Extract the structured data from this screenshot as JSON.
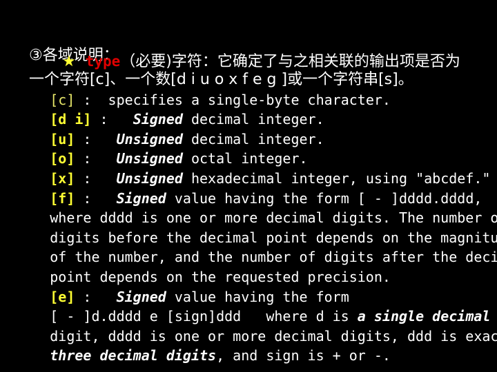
{
  "slide": {
    "background_color": "#000000",
    "text_color": "#ffffff",
    "accent_yellow": "#ffff33",
    "accent_yellow_dim": "#e8e86a",
    "accent_red": "#e00000",
    "heading": "③各域说明：",
    "bullet_icon": "★",
    "bullet": {
      "keyword": "type",
      "text_after_keyword": "（必要)字符：它确定了与之相关联的输出项是否为",
      "continuation": "一个字符[c]、一个数[d i u o x f e g ]或一个字符串[s]。"
    },
    "entries": [
      {
        "tag": "[c]",
        "tag_style": "dim",
        "colon": ":",
        "emphasis": "",
        "text": "  specifies a single-byte character."
      },
      {
        "tag": "[d i]",
        "tag_style": "bold",
        "colon": ":",
        "emphasis": "Signed",
        "text": " decimal integer."
      },
      {
        "tag": "[u]",
        "tag_style": "bold",
        "colon": ":",
        "emphasis": "Unsigned",
        "text": " decimal integer."
      },
      {
        "tag": "[o]",
        "tag_style": "bold",
        "colon": ":",
        "emphasis": "Unsigned",
        "text": " octal integer."
      },
      {
        "tag": "[x]",
        "tag_style": "bold",
        "colon": ":",
        "emphasis": "Unsigned",
        "text": " hexadecimal integer, using \"abcdef.\""
      },
      {
        "tag": "[f]",
        "tag_style": "bold",
        "colon": ":",
        "emphasis": "Signed",
        "text": " value having the form [ - ]dddd.dddd,"
      }
    ],
    "f_paragraph": [
      "where dddd is one or more decimal digits. The number of",
      "digits before the decimal point depends on the magnitude",
      "of the number, and the number of digits after the decimal",
      "point depends on the requested precision."
    ],
    "e_entry": {
      "tag": "[e]",
      "tag_style": "bold",
      "colon": ":",
      "emphasis": "Signed",
      "text": " value having the form"
    },
    "e_paragraph": {
      "line1_pre": "[ - ]d.dddd e [sign]ddd   where d is ",
      "line1_emphasis": "a single decimal",
      "line2_pre": "digit, dddd is one or more decimal digits, ddd is exactly",
      "line3_emphasis": "three decimal digits",
      "line3_post": ", and sign is + or -."
    }
  }
}
